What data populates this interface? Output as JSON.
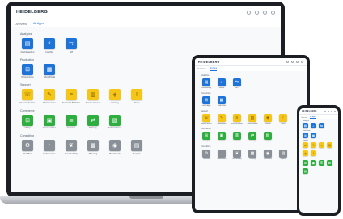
{
  "app": {
    "logo_text": "HEIDELBERG",
    "tabs": [
      {
        "label": "Overview",
        "active": false
      },
      {
        "label": "All Apps",
        "active": true
      }
    ],
    "topbar_icons": [
      "help-icon",
      "user-icon",
      "settings-icon",
      "menu-icon"
    ]
  },
  "sections": [
    {
      "title": "Analytics",
      "color": "#1d73d8",
      "tiles": [
        {
          "label": "Dashboarding",
          "icon": "chart-icon"
        },
        {
          "label": "Insights",
          "icon": "magnifier-icon"
        },
        {
          "label": "API",
          "icon": "api-icon"
        }
      ]
    },
    {
      "title": "Production",
      "color": "#1d73d8",
      "tiles": [
        {
          "label": "Prinect Apps",
          "icon": "cart-icon"
        },
        {
          "label": "Shop Portal",
          "icon": "calendar-icon"
        }
      ]
    },
    {
      "title": "Support",
      "color": "#f5c518",
      "tiles": [
        {
          "label": "Remote Service",
          "icon": "support-icon"
        },
        {
          "label": "Maintenance",
          "icon": "wrench-icon"
        },
        {
          "label": "Technical Bulletins",
          "icon": "bulletin-icon"
        },
        {
          "label": "Service Manual",
          "icon": "manual-icon"
        },
        {
          "label": "Training",
          "icon": "training-icon"
        },
        {
          "label": "Alerts",
          "icon": "alert-icon"
        }
      ]
    },
    {
      "title": "Commerce",
      "color": "#2eae3f",
      "tiles": [
        {
          "label": "eShop",
          "icon": "shop-icon"
        },
        {
          "label": "Consumables",
          "icon": "box-icon"
        },
        {
          "label": "Invoices",
          "icon": "invoice-icon"
        },
        {
          "label": "Delivery",
          "icon": "truck-icon"
        },
        {
          "label": "Subscriptions",
          "icon": "subscription-icon"
        }
      ]
    },
    {
      "title": "Consulting",
      "color": "#8a9097",
      "tiles": [
        {
          "label": "Workflow",
          "icon": "workflow-icon"
        },
        {
          "label": "Performance",
          "icon": "gauge-icon"
        },
        {
          "label": "Sustainability",
          "icon": "leaf-icon"
        },
        {
          "label": "Planning",
          "icon": "plan-icon"
        },
        {
          "label": "Benchmark",
          "icon": "benchmark-icon"
        },
        {
          "label": "Reports",
          "icon": "report-icon"
        }
      ]
    }
  ]
}
